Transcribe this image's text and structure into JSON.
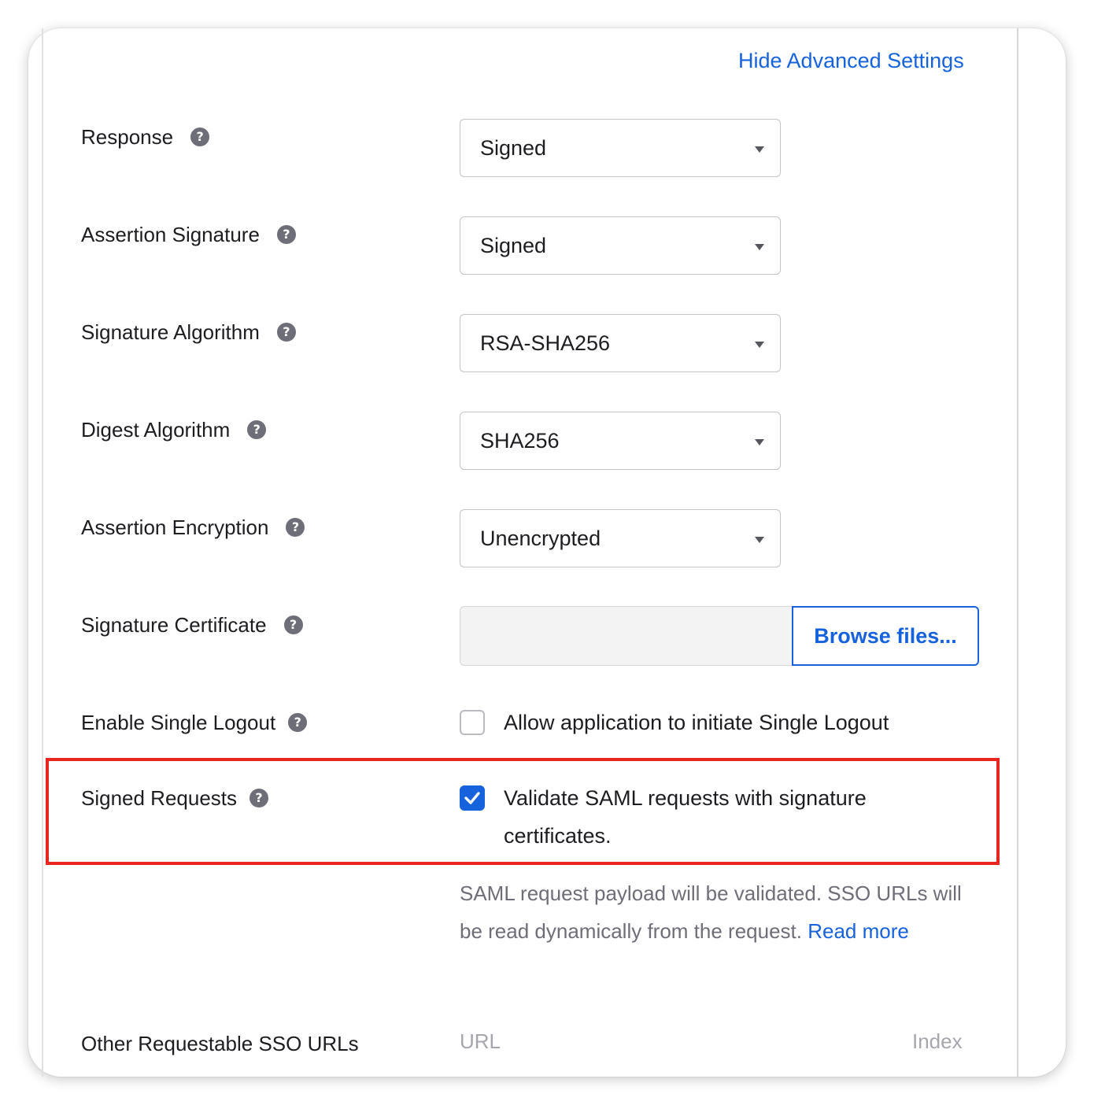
{
  "header": {
    "hide_advanced_label": "Hide Advanced Settings"
  },
  "fields": {
    "response": {
      "label": "Response",
      "value": "Signed"
    },
    "assertion_signature": {
      "label": "Assertion Signature",
      "value": "Signed"
    },
    "signature_algorithm": {
      "label": "Signature Algorithm",
      "value": "RSA-SHA256"
    },
    "digest_algorithm": {
      "label": "Digest Algorithm",
      "value": "SHA256"
    },
    "assertion_encryption": {
      "label": "Assertion Encryption",
      "value": "Unencrypted"
    },
    "signature_certificate": {
      "label": "Signature Certificate",
      "button_label": "Browse files...",
      "file_value": ""
    },
    "single_logout": {
      "label": "Enable Single Logout",
      "checkbox_label": "Allow application to initiate Single Logout",
      "checked": false
    },
    "signed_requests": {
      "label": "Signed Requests",
      "checkbox_label_line1": "Validate SAML requests with signature",
      "checkbox_label_line2": "certificates.",
      "checked": true,
      "helper_text": "SAML request payload will be validated. SSO URLs will be read dynamically from the request.",
      "read_more_label": "Read more"
    },
    "other_sso_urls": {
      "label": "Other Requestable SSO URLs",
      "url_header": "URL",
      "index_header": "Index"
    }
  },
  "icons": {
    "help": "help-circle-icon",
    "caret": "caret-down-icon",
    "check": "checkmark-icon"
  },
  "colors": {
    "accent": "#1662dd",
    "highlight": "#e8261e",
    "muted_text": "#6e6e78"
  }
}
